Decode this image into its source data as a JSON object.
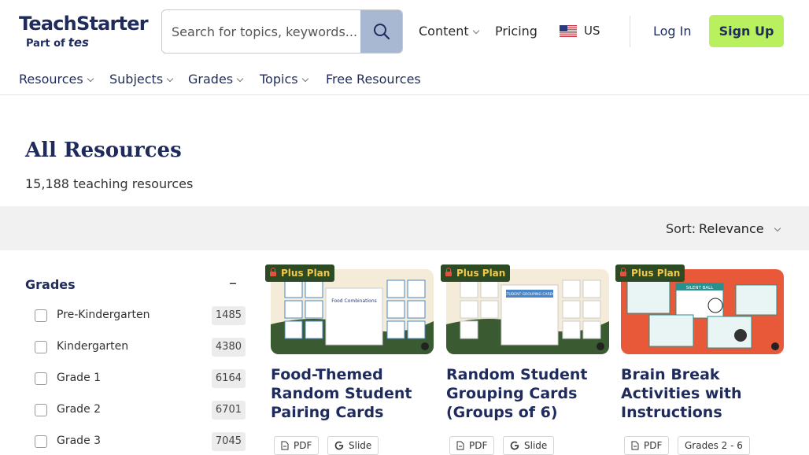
{
  "brand": {
    "name": "TeachStarter",
    "sub_prefix": "Part of",
    "sub_brand": "tes"
  },
  "search": {
    "placeholder": "Search for topics, keywords..."
  },
  "topnav": {
    "content": "Content",
    "pricing": "Pricing",
    "region": "US",
    "login": "Log In",
    "signup": "Sign Up"
  },
  "mainnav": {
    "items": [
      "Resources",
      "Subjects",
      "Grades",
      "Topics",
      "Free Resources"
    ]
  },
  "page": {
    "title": "All Resources",
    "count": "15,188 teaching resources"
  },
  "sort": {
    "label": "Sort:",
    "value": "Relevance"
  },
  "filters": {
    "title": "Grades",
    "collapse": "–",
    "grades": [
      {
        "label": "Pre-Kindergarten",
        "count": "1485"
      },
      {
        "label": "Kindergarten",
        "count": "4380"
      },
      {
        "label": "Grade 1",
        "count": "6164"
      },
      {
        "label": "Grade 2",
        "count": "6701"
      },
      {
        "label": "Grade 3",
        "count": "7045"
      }
    ]
  },
  "cards": [
    {
      "badge": "Plus Plan",
      "title": "Food-Themed Random Student Pairing Cards",
      "tags": [
        "PDF",
        "Slide"
      ],
      "image_title": "Food Combinations",
      "image_colors": [
        "#e8f0f8",
        "#5b9bd5"
      ]
    },
    {
      "badge": "Plus Plan",
      "title": "Random Student Grouping Cards (Groups of 6)",
      "tags": [
        "PDF",
        "Slide"
      ],
      "image_title": "STUDENT GROUPING CARDS",
      "image_colors": [
        "#e8f0f8",
        "#4a86c5"
      ]
    },
    {
      "badge": "Plus Plan",
      "title": "Brain Break Activities with Instructions",
      "tags": [
        "PDF",
        "Grades 2 - 6"
      ],
      "image_title": "SILENT BALL",
      "image_colors": [
        "#e8593a",
        "#2a8f8f"
      ]
    }
  ],
  "colors": {
    "brand_navy": "#1e2b5c",
    "signup_green": "#b8f15d",
    "search_btn": "#a8b8d2",
    "badge_bg": "#2c4a24",
    "badge_text": "#f2c84b"
  }
}
